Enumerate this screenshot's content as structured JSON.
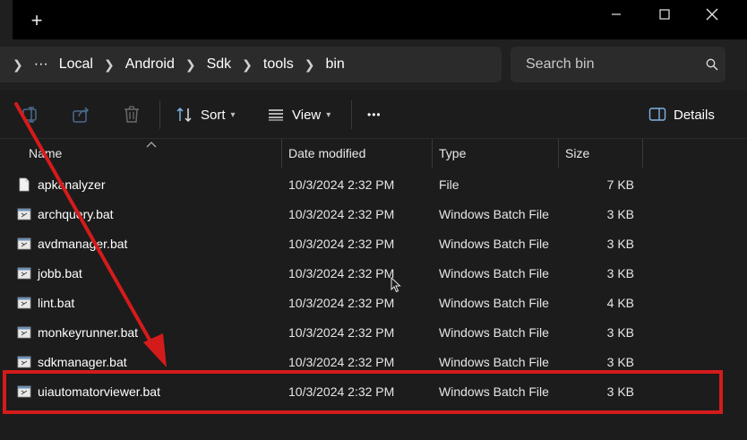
{
  "titlebar": {
    "new_tab_glyph": "+",
    "controls": [
      "minimize",
      "maximize",
      "close"
    ]
  },
  "address": {
    "overflow_glyph": "···",
    "crumbs": [
      "Local",
      "Android",
      "Sdk",
      "tools",
      "bin"
    ]
  },
  "search": {
    "placeholder": "Search bin"
  },
  "toolbar": {
    "sort_label": "Sort",
    "view_label": "View",
    "more_glyph": "•••",
    "details_label": "Details"
  },
  "columns": {
    "name": "Name",
    "date": "Date modified",
    "type": "Type",
    "size": "Size"
  },
  "files": [
    {
      "name": "apkanalyzer",
      "date": "10/3/2024 2:32 PM",
      "type": "File",
      "size": "7 KB",
      "icon": "file-icon"
    },
    {
      "name": "archquery.bat",
      "date": "10/3/2024 2:32 PM",
      "type": "Windows Batch File",
      "size": "3 KB",
      "icon": "batch-file-icon"
    },
    {
      "name": "avdmanager.bat",
      "date": "10/3/2024 2:32 PM",
      "type": "Windows Batch File",
      "size": "3 KB",
      "icon": "batch-file-icon"
    },
    {
      "name": "jobb.bat",
      "date": "10/3/2024 2:32 PM",
      "type": "Windows Batch File",
      "size": "3 KB",
      "icon": "batch-file-icon"
    },
    {
      "name": "lint.bat",
      "date": "10/3/2024 2:32 PM",
      "type": "Windows Batch File",
      "size": "4 KB",
      "icon": "batch-file-icon"
    },
    {
      "name": "monkeyrunner.bat",
      "date": "10/3/2024 2:32 PM",
      "type": "Windows Batch File",
      "size": "3 KB",
      "icon": "batch-file-icon"
    },
    {
      "name": "sdkmanager.bat",
      "date": "10/3/2024 2:32 PM",
      "type": "Windows Batch File",
      "size": "3 KB",
      "icon": "batch-file-icon"
    },
    {
      "name": "uiautomatorviewer.bat",
      "date": "10/3/2024 2:32 PM",
      "type": "Windows Batch File",
      "size": "3 KB",
      "icon": "batch-file-icon"
    }
  ],
  "colors": {
    "background": "#1c1c1c",
    "titlebar": "#000000",
    "address_bar": "#2b2b2b",
    "annotation_red": "#d41b1b",
    "toolbar_icon_disabled": "#4a6a8c"
  }
}
